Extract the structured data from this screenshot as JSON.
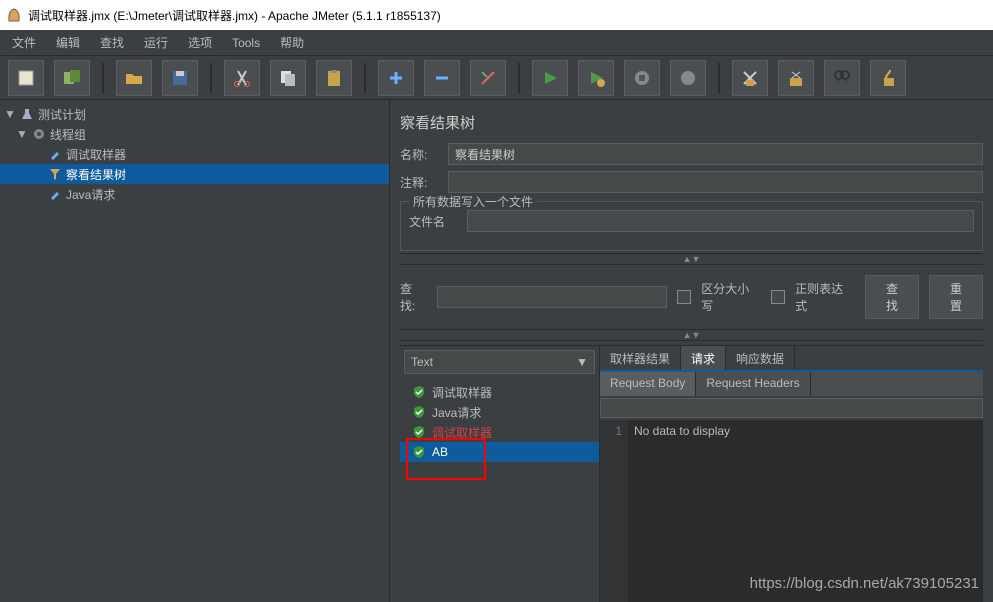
{
  "window": {
    "title": "调试取样器.jmx (E:\\Jmeter\\调试取样器.jmx) - Apache JMeter (5.1.1 r1855137)"
  },
  "menu": {
    "file": "文件",
    "edit": "编辑",
    "search": "查找",
    "run": "运行",
    "options": "选项",
    "tools": "Tools",
    "help": "帮助"
  },
  "tree": {
    "root": "测试计划",
    "threadGroup": "线程组",
    "debugSampler": "调试取样器",
    "viewResults": "察看结果树",
    "javaRequest": "Java请求"
  },
  "panel": {
    "title": "察看结果树",
    "nameLabel": "名称:",
    "nameValue": "察看结果树",
    "commentLabel": "注释:",
    "commentValue": "",
    "writeGroupLabel": "所有数据写入一个文件",
    "filenameLabel": "文件名"
  },
  "searchBar": {
    "label": "查找:",
    "caseSensitive": "区分大小写",
    "regex": "正则表达式",
    "searchBtn": "查找",
    "resetBtn": "重置"
  },
  "renderer": "Text",
  "results": [
    "调试取样器",
    "Java请求",
    "调试取样器",
    "AB"
  ],
  "tabs": {
    "samplerResult": "取样器结果",
    "request": "请求",
    "response": "响应数据"
  },
  "subtabs": {
    "body": "Request Body",
    "headers": "Request Headers"
  },
  "editor": {
    "line1": "1",
    "content": "No data to display"
  },
  "watermark": "https://blog.csdn.net/ak739105231"
}
